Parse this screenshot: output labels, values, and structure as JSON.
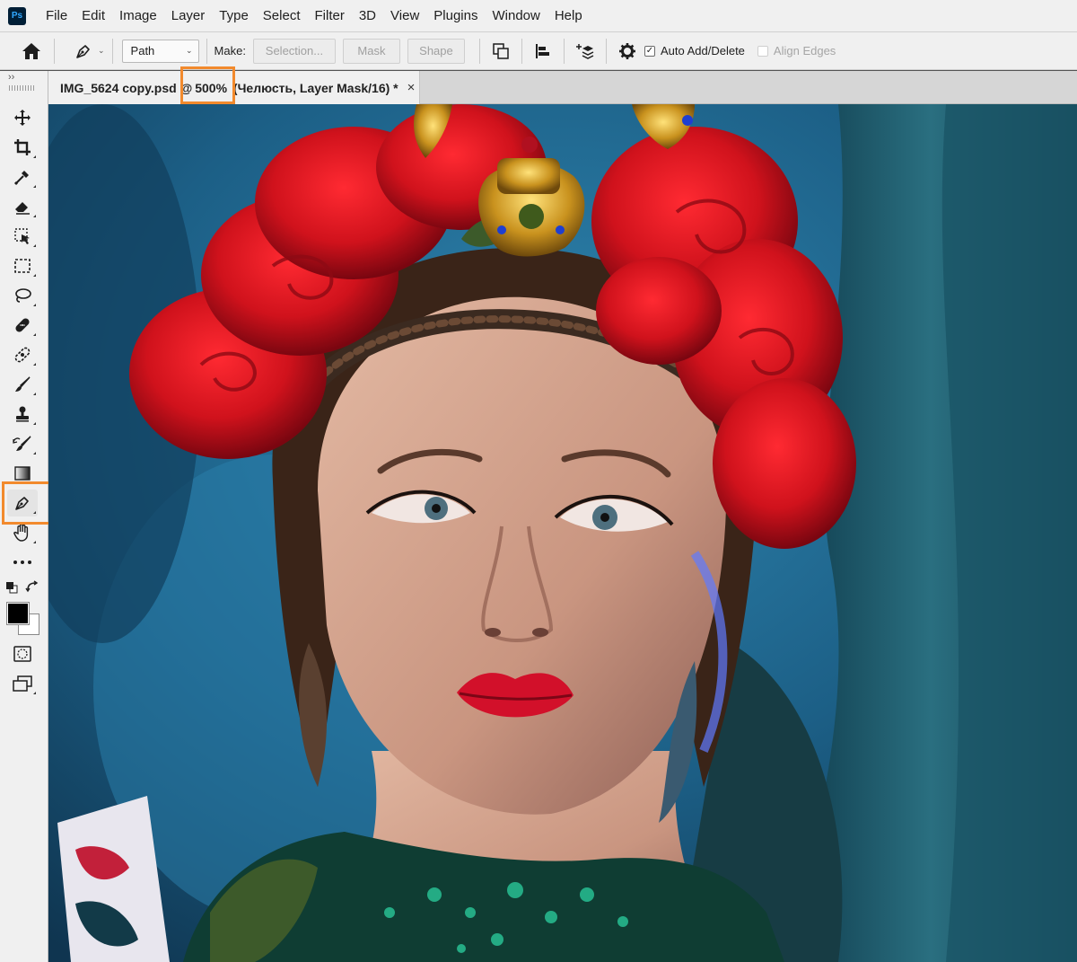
{
  "app": {
    "logo_text": "Ps"
  },
  "menu": [
    "File",
    "Edit",
    "Image",
    "Layer",
    "Type",
    "Select",
    "Filter",
    "3D",
    "View",
    "Plugins",
    "Window",
    "Help"
  ],
  "options_bar": {
    "mode_select": "Path",
    "make_label": "Make:",
    "buttons": {
      "selection": "Selection...",
      "mask": "Mask",
      "shape": "Shape"
    },
    "auto_add_delete": {
      "label": "Auto Add/Delete",
      "checked": true
    },
    "align_edges": {
      "label": "Align Edges",
      "checked": false,
      "enabled": false
    }
  },
  "toolbar": {
    "expand_glyph": "››",
    "tools": [
      {
        "name": "move-tool"
      },
      {
        "name": "crop-tool"
      },
      {
        "name": "eyedropper-tool"
      },
      {
        "name": "eraser-tool"
      },
      {
        "name": "object-selection-tool"
      },
      {
        "name": "marquee-tool"
      },
      {
        "name": "lasso-tool"
      },
      {
        "name": "spot-healing-tool"
      },
      {
        "name": "patch-tool"
      },
      {
        "name": "brush-tool"
      },
      {
        "name": "clone-stamp-tool"
      },
      {
        "name": "history-brush-tool"
      },
      {
        "name": "gradient-tool"
      },
      {
        "name": "pen-tool",
        "active": true
      },
      {
        "name": "hand-tool"
      },
      {
        "name": "more-tools"
      }
    ],
    "foreground_color": "#000000",
    "background_color": "#ffffff"
  },
  "document_tab": {
    "title_prefix": "IMG_5624 copy.psd @",
    "zoom": "500%",
    "title_suffix": " (Челюсть, Layer Mask/16) *",
    "close_glyph": "×"
  },
  "colors": {
    "highlight": "#f28a2d",
    "panel_bg": "#f0f0f0",
    "active_tool_bg": "#e4e4e4"
  }
}
